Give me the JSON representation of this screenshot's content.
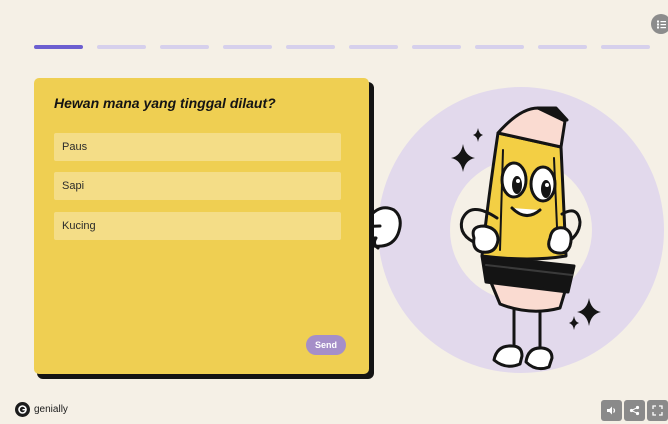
{
  "progress": {
    "total": 10,
    "current": 1
  },
  "quiz": {
    "question": "Hewan mana yang tinggal dilaut?",
    "options": [
      "Paus",
      "Sapi",
      "Kucing"
    ],
    "send_label": "Send"
  },
  "brand": {
    "name": "genially"
  },
  "icons": {
    "menu": "checklist-icon",
    "logo": "genially-logo-icon",
    "sound": "speaker-icon",
    "share": "share-icon",
    "fullscreen": "fullscreen-icon",
    "pointer": "pointing-hand-icon",
    "mascot": "pencil-character-icon",
    "sparkle": "sparkle-icon"
  },
  "colors": {
    "background": "#f5f0e6",
    "card": "#efcf52",
    "option": "#f4dd87",
    "progress_active": "#6c5fd0",
    "progress_inactive": "#d6d0ec",
    "send_button": "#a58fc8",
    "circle": "#e2d9ec",
    "pencil": "#f3cf44"
  }
}
